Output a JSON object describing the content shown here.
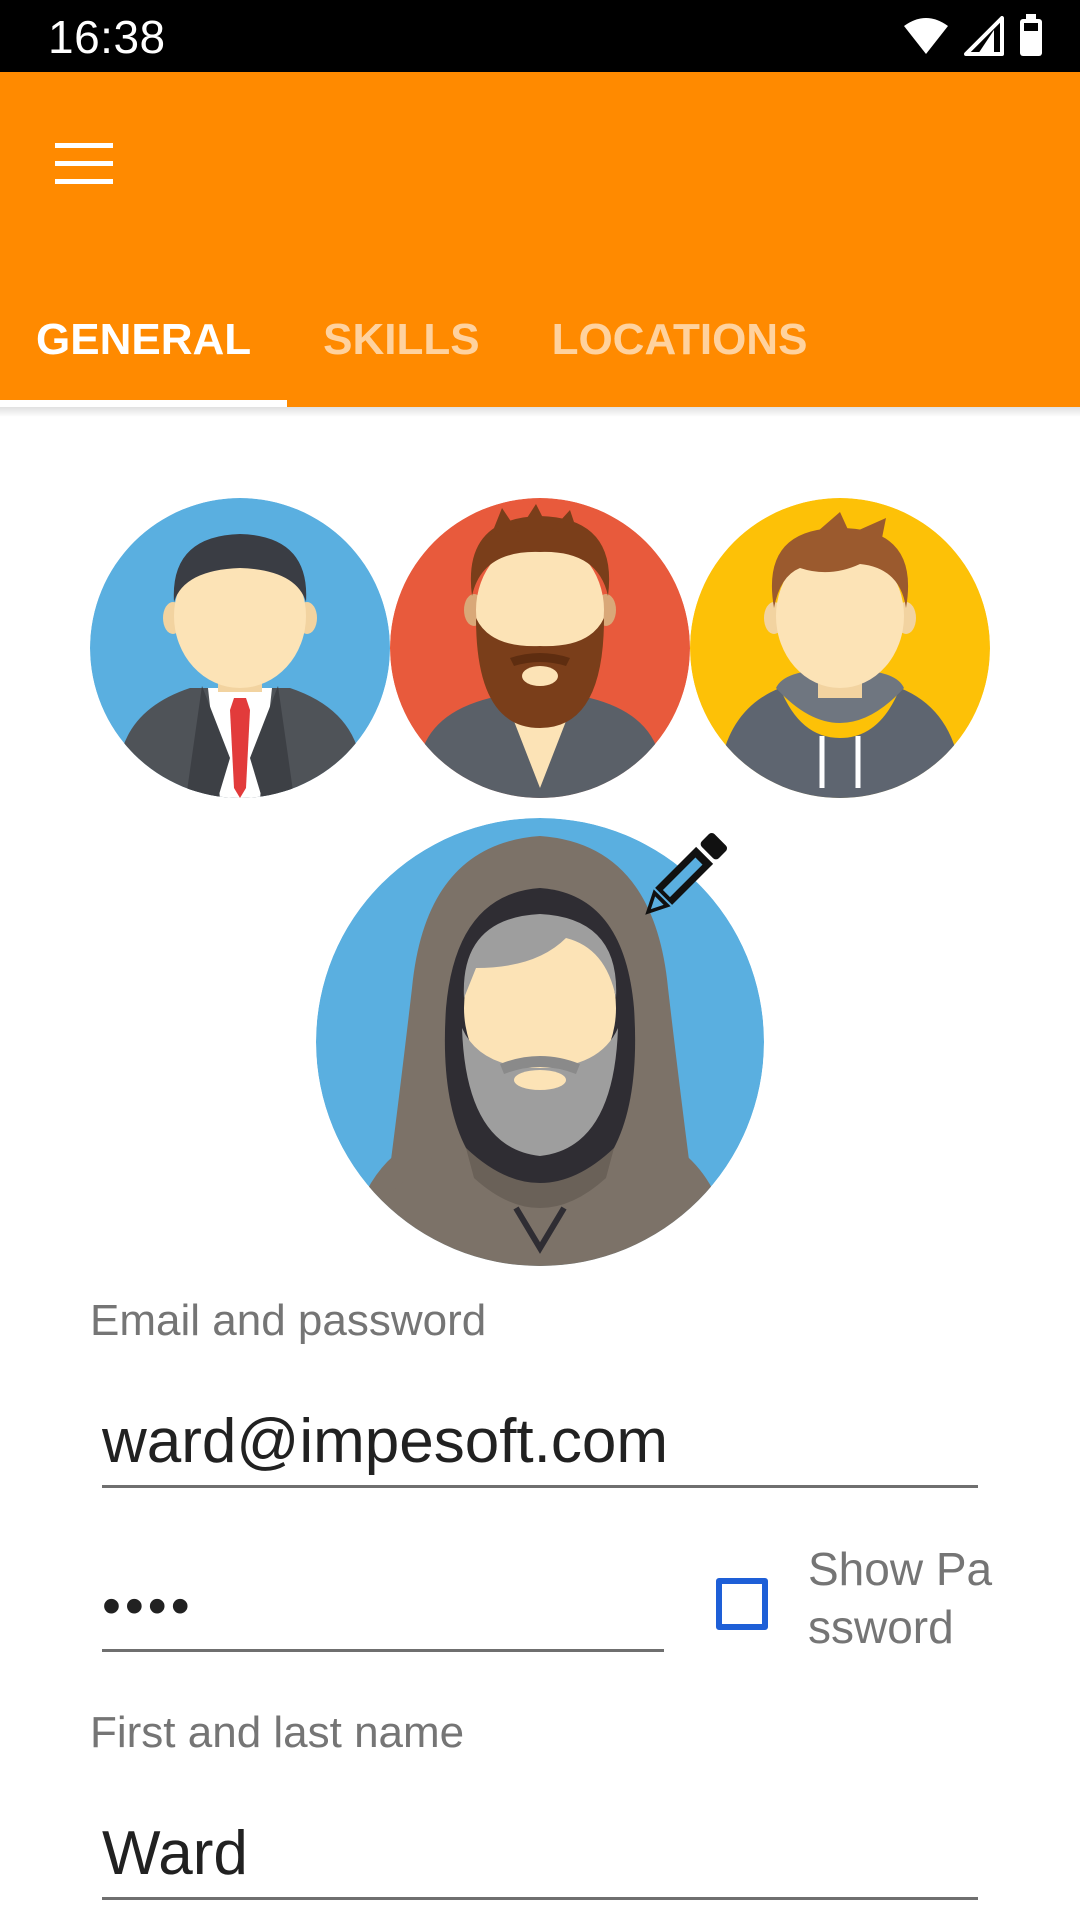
{
  "status_bar": {
    "time": "16:38",
    "icons": [
      "wifi-icon",
      "cell-signal-icon",
      "battery-icon"
    ]
  },
  "app_bar": {
    "color": "#ff8a00",
    "menu_icon": "hamburger-menu-icon",
    "tabs": [
      {
        "label": "GENERAL",
        "active": true
      },
      {
        "label": "SKILLS",
        "active": false
      },
      {
        "label": "LOCATIONS",
        "active": false
      }
    ]
  },
  "avatars": {
    "options": [
      {
        "name": "businessman-avatar",
        "background": "#5aafe0"
      },
      {
        "name": "bearded-man-avatar",
        "background": "#e85a3c"
      },
      {
        "name": "hoodie-man-avatar",
        "background": "#fdc107"
      }
    ],
    "selected": {
      "name": "hooded-old-man-avatar",
      "background": "#5aafe0"
    },
    "edit_icon": "pencil-icon"
  },
  "form": {
    "email_section_label": "Email and password",
    "email_value": "ward@impesoft.com",
    "password_value": "••••",
    "show_password_label": "Show Password",
    "show_password_checked": false,
    "name_section_label": "First and last name",
    "first_name_value": "Ward"
  }
}
